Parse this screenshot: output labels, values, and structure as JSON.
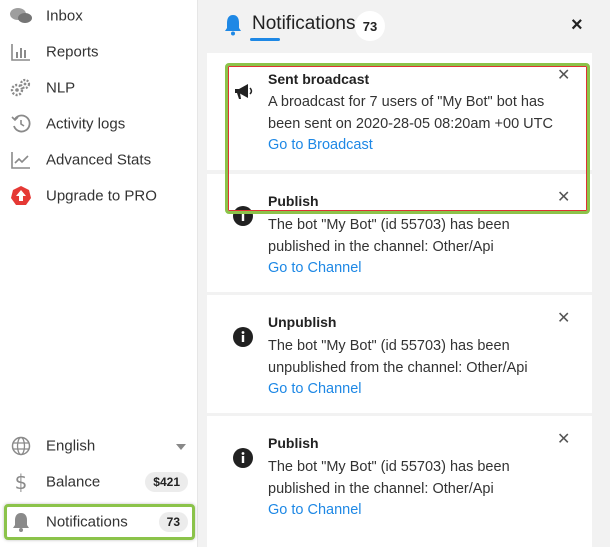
{
  "sidebar": {
    "items": [
      {
        "label": "Inbox",
        "icon": "chat-bubbles-icon"
      },
      {
        "label": "Reports",
        "icon": "bar-chart-icon"
      },
      {
        "label": "NLP",
        "icon": "gears-icon"
      },
      {
        "label": "Activity logs",
        "icon": "history-icon"
      },
      {
        "label": "Advanced Stats",
        "icon": "line-chart-icon"
      },
      {
        "label": "Upgrade to PRO",
        "icon": "upgrade-icon"
      }
    ],
    "language": {
      "label": "English",
      "icon": "globe-icon"
    },
    "balance": {
      "label": "Balance",
      "value": "$421",
      "icon": "dollar-icon"
    },
    "notifications": {
      "label": "Notifications",
      "count": "73",
      "icon": "bell-icon"
    }
  },
  "panel": {
    "title": "Notifications",
    "count": "73",
    "close": "×",
    "notifications": [
      {
        "type": "broadcast",
        "title": "Sent broadcast",
        "line1": "A broadcast for 7 users of \"My Bot\" bot has",
        "line2": "been sent on 2020-28-05 08:20am +00 UTC",
        "link": "Go to Broadcast"
      },
      {
        "type": "info",
        "title": "Publish",
        "line1": "The bot \"My Bot\" (id 55703) has been",
        "line2": "published in the channel: Other/Api",
        "link": "Go to Channel"
      },
      {
        "type": "info",
        "title": "Unpublish",
        "line1": "The bot \"My Bot\" (id 55703) has been",
        "line2": "unpublished from the channel: Other/Api",
        "link": "Go to Channel"
      },
      {
        "type": "info",
        "title": "Publish",
        "line1": "The bot \"My Bot\" (id 55703) has been",
        "line2": "published in the channel: Other/Api",
        "link": "Go to Channel"
      }
    ]
  },
  "colors": {
    "accent": "#1e88e5",
    "highlight": "#8bc34a",
    "upgrade": "#e53935",
    "panel_bg": "#f2f2f2"
  }
}
